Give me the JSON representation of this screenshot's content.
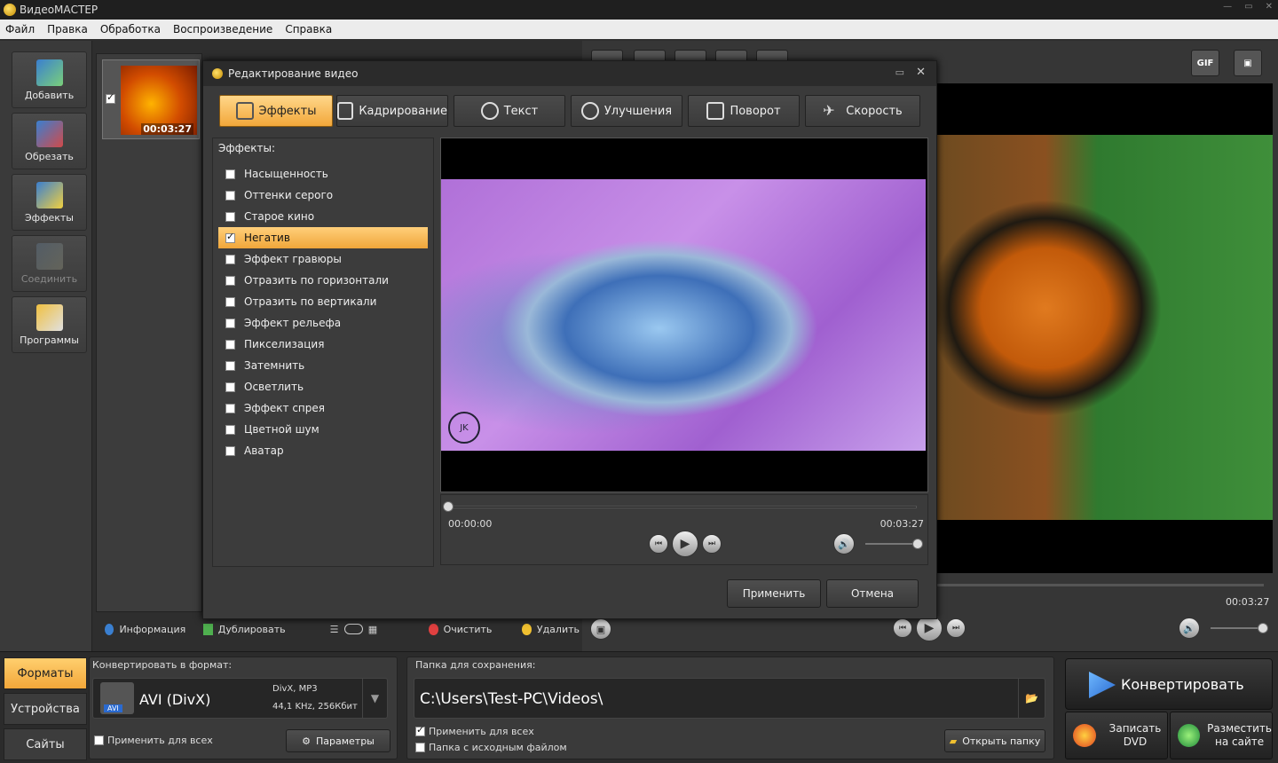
{
  "app": {
    "title": "ВидеоМАСТЕР"
  },
  "menu": [
    "Файл",
    "Правка",
    "Обработка",
    "Воспроизведение",
    "Справка"
  ],
  "tools": [
    {
      "label": "Добавить",
      "icon": "add-video-icon"
    },
    {
      "label": "Обрезать",
      "icon": "cut-icon"
    },
    {
      "label": "Эффекты",
      "icon": "effects-icon"
    },
    {
      "label": "Соединить",
      "icon": "join-icon"
    },
    {
      "label": "Программы",
      "icon": "programs-icon"
    }
  ],
  "file": {
    "duration": "00:03:27"
  },
  "fileToolbar": {
    "info": "Информация",
    "duplicate": "Дублировать",
    "clear": "Очистить",
    "delete": "Удалить"
  },
  "player": {
    "total": "00:03:27"
  },
  "topButtons": {
    "gif": "GIF"
  },
  "dialog": {
    "title": "Редактирование видео",
    "tabs": [
      "Эффекты",
      "Кадрирование",
      "Текст",
      "Улучшения",
      "Поворот",
      "Скорость"
    ],
    "effectsHeader": "Эффекты:",
    "effects": [
      {
        "label": "Насыщенность",
        "checked": false
      },
      {
        "label": "Оттенки серого",
        "checked": false
      },
      {
        "label": "Старое кино",
        "checked": false
      },
      {
        "label": "Негатив",
        "checked": true
      },
      {
        "label": "Эффект гравюры",
        "checked": false
      },
      {
        "label": "Отразить по горизонтали",
        "checked": false
      },
      {
        "label": "Отразить по вертикали",
        "checked": false
      },
      {
        "label": "Эффект рельефа",
        "checked": false
      },
      {
        "label": "Пикселизация",
        "checked": false
      },
      {
        "label": "Затемнить",
        "checked": false
      },
      {
        "label": "Осветлить",
        "checked": false
      },
      {
        "label": "Эффект спрея",
        "checked": false
      },
      {
        "label": "Цветной шум",
        "checked": false
      },
      {
        "label": "Аватар",
        "checked": false
      }
    ],
    "time_start": "00:00:00",
    "time_end": "00:03:27",
    "apply": "Применить",
    "cancel": "Отмена"
  },
  "bottom": {
    "tabs": [
      "Форматы",
      "Устройства",
      "Сайты"
    ],
    "formatLabel": "Конвертировать в формат:",
    "format": {
      "name": "AVI (DivX)",
      "codec": "DivX, MP3",
      "params": "44,1 KHz, 256Кбит",
      "badge": "AVI"
    },
    "applyAll": "Применить для всех",
    "params": "Параметры",
    "folderLabel": "Папка для сохранения:",
    "folderPath": "C:\\Users\\Test-PC\\Videos\\",
    "applyAll2": "Применить для всех",
    "sourceFolder": "Папка с исходным файлом",
    "openFolder": "Открыть папку",
    "convert": "Конвертировать",
    "dvd_line1": "Записать",
    "dvd_line2": "DVD",
    "web_line1": "Разместить",
    "web_line2": "на сайте"
  }
}
